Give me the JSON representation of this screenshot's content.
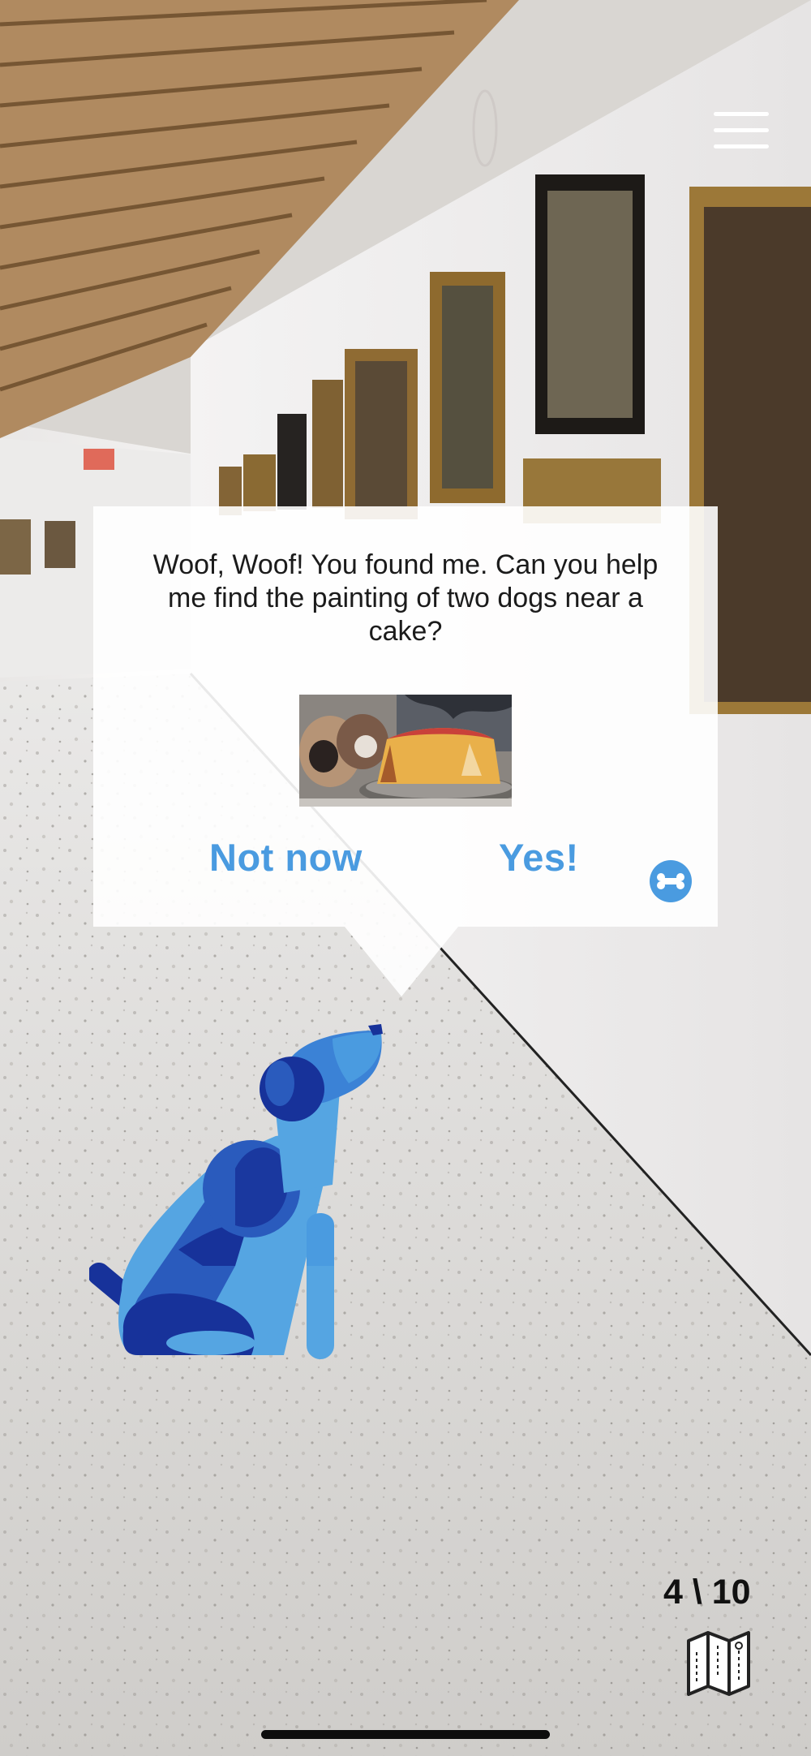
{
  "dialog": {
    "message": "Woof, Woof! You found me. Can you help me find the painting of two dogs near a cake?",
    "not_now_label": "Not now",
    "yes_label": "Yes!"
  },
  "hud": {
    "progress_text": "4 \\ 10"
  },
  "icons": {
    "menu": "hamburger-menu-icon",
    "bone": "bone-icon",
    "map": "folded-map-icon"
  },
  "colors": {
    "accent": "#4a9be0",
    "dog_light": "#55a5e2",
    "dog_mid": "#2a5bbd",
    "dog_dark": "#17329a"
  }
}
